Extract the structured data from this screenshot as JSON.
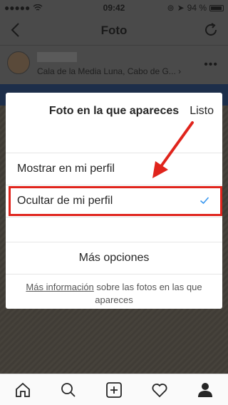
{
  "status_bar": {
    "time": "09:42",
    "battery": "94 %"
  },
  "nav": {
    "title": "Foto"
  },
  "post": {
    "location": "Cala de la Media Luna, Cabo de G... ›",
    "more": "•••"
  },
  "sheet": {
    "title": "Foto en la que apareces",
    "done_label": "Listo",
    "options": [
      {
        "label": "Mostrar en mi perfil",
        "selected": false
      },
      {
        "label": "Ocultar de mi perfil",
        "selected": true
      }
    ],
    "more_options_label": "Más opciones",
    "info_link": "Más información",
    "info_text": " sobre las fotos en las que apareces"
  },
  "tab_bar": {
    "icons": [
      "home-icon",
      "search-icon",
      "add-icon",
      "heart-icon",
      "profile-icon"
    ]
  },
  "colors": {
    "highlight": "#e0241c",
    "check": "#3897f0"
  }
}
